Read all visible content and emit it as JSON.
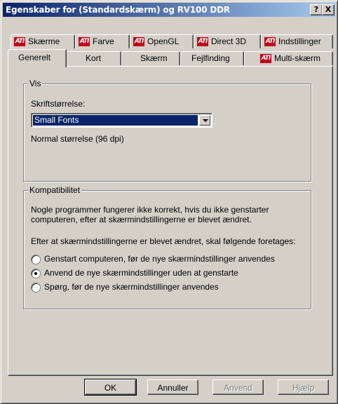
{
  "window": {
    "title": "Egenskaber for (Standardskærm) og RV100 DDR"
  },
  "titlebar_buttons": {
    "help": "?",
    "close": "X"
  },
  "tabs_row1": [
    {
      "label": "Skærme",
      "ati": true
    },
    {
      "label": "Farve",
      "ati": true
    },
    {
      "label": "OpenGL",
      "ati": true
    },
    {
      "label": "Direct 3D",
      "ati": true
    },
    {
      "label": "Indstillinger",
      "ati": true
    }
  ],
  "tabs_row2": [
    {
      "label": "Generelt",
      "selected": true
    },
    {
      "label": "Kort"
    },
    {
      "label": "Skærm"
    },
    {
      "label": "Fejlfinding"
    },
    {
      "label": "Multi-skærm",
      "ati": true
    }
  ],
  "vis": {
    "legend": "Vis",
    "font_size_label": "Skriftstørrelse:",
    "font_size_value": "Small Fonts",
    "size_note": "Normal størrelse (96 dpi)"
  },
  "compat": {
    "legend": "Kompatibilitet",
    "line1": "Nogle programmer fungerer ikke korrekt, hvis du ikke genstarter",
    "line2": "computeren, efter at skærmindstillingerne er blevet ændret.",
    "line3": "Efter at skærmindstillingerne er blevet ændret, skal følgende foretages:",
    "options": [
      {
        "label": "Genstart computeren, før de nye skærmindstillinger anvendes",
        "checked": false
      },
      {
        "label": "Anvend de nye skærmindstillinger uden at genstarte",
        "checked": true
      },
      {
        "label": "Spørg, før de nye skærmindstillinger anvendes",
        "checked": false
      }
    ]
  },
  "buttons": {
    "ok": "OK",
    "cancel": "Annuller",
    "apply": "Anvend",
    "help": "Hjælp"
  },
  "ati_logo_text": "ATI"
}
